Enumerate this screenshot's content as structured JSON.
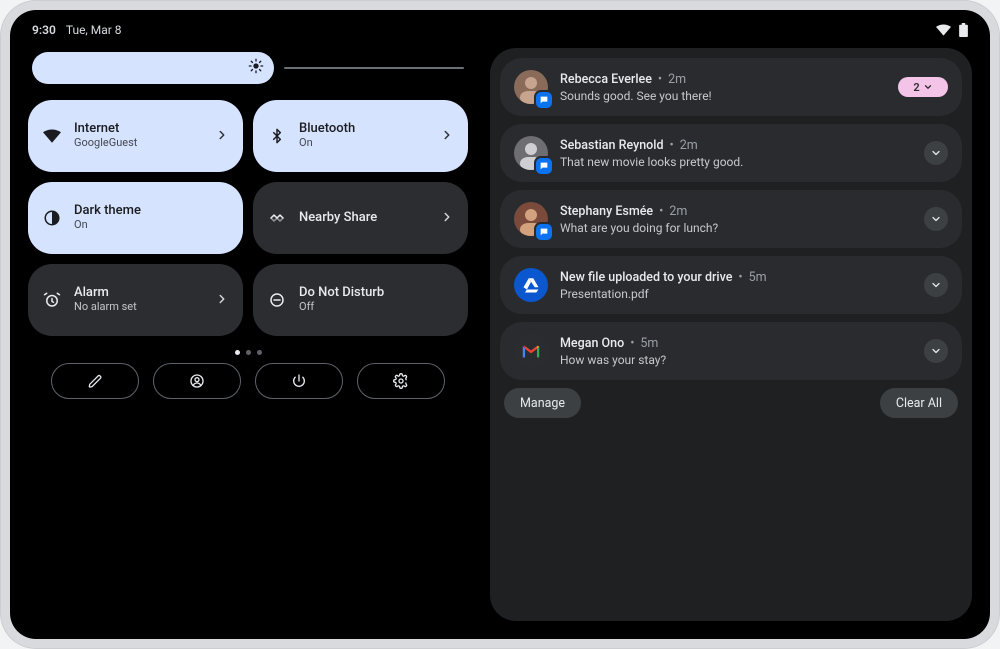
{
  "status": {
    "time": "9:30",
    "date": "Tue, Mar 8"
  },
  "brightness": {
    "percent": 56
  },
  "tiles": [
    {
      "id": "internet",
      "title": "Internet",
      "subtitle": "GoogleGuest",
      "active": true,
      "chevron": true,
      "icon": "wifi"
    },
    {
      "id": "bluetooth",
      "title": "Bluetooth",
      "subtitle": "On",
      "active": true,
      "chevron": true,
      "icon": "bluetooth"
    },
    {
      "id": "darktheme",
      "title": "Dark theme",
      "subtitle": "On",
      "active": true,
      "chevron": false,
      "icon": "contrast"
    },
    {
      "id": "nearby",
      "title": "Nearby Share",
      "subtitle": "",
      "active": false,
      "chevron": true,
      "icon": "nearby"
    },
    {
      "id": "alarm",
      "title": "Alarm",
      "subtitle": "No alarm set",
      "active": false,
      "chevron": true,
      "icon": "alarm"
    },
    {
      "id": "dnd",
      "title": "Do Not Disturb",
      "subtitle": "Off",
      "active": false,
      "chevron": false,
      "icon": "dnd"
    }
  ],
  "pager": {
    "count": 3,
    "active": 0
  },
  "actions": [
    {
      "id": "edit",
      "icon": "pencil"
    },
    {
      "id": "user",
      "icon": "user"
    },
    {
      "id": "power",
      "icon": "power"
    },
    {
      "id": "settings",
      "icon": "gear"
    }
  ],
  "notifications": {
    "items": [
      {
        "kind": "message",
        "app": "messages",
        "title": "Rebecca Everlee",
        "time_label": "2m",
        "subtitle": "Sounds good. See you there!",
        "badge_count": 2,
        "avatar_tone": "#8a6b5a"
      },
      {
        "kind": "message",
        "app": "messages",
        "title": "Sebastian Reynold",
        "time_label": "2m",
        "subtitle": "That new movie looks pretty good.",
        "avatar_tone": "#6e6e72"
      },
      {
        "kind": "message",
        "app": "messages",
        "title": "Stephany Esmée",
        "time_label": "2m",
        "subtitle": "What are you doing for lunch?",
        "avatar_tone": "#7a4a3a"
      },
      {
        "kind": "drive",
        "title": "New file uploaded to your drive",
        "time_label": "5m",
        "subtitle": "Presentation.pdf"
      },
      {
        "kind": "gmail",
        "title": "Megan Ono",
        "time_label": "5m",
        "subtitle": "How was your stay?"
      }
    ],
    "manage_label": "Manage",
    "clear_all_label": "Clear All"
  }
}
